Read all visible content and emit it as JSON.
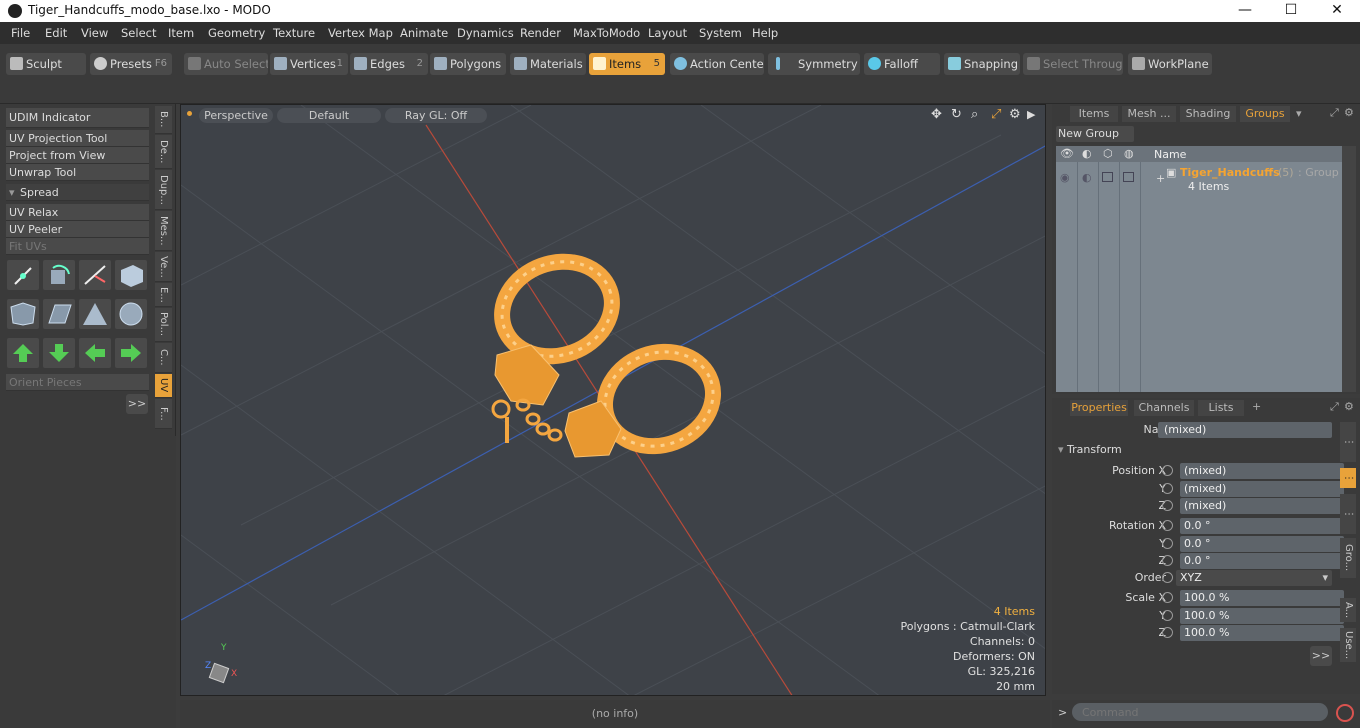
{
  "window": {
    "title": "Tiger_Handcuffs_modo_base.lxo - MODO",
    "min": "—",
    "max": "☐",
    "close": "✕"
  },
  "menu": [
    "File",
    "Edit",
    "View",
    "Select",
    "Item",
    "Geometry",
    "Texture",
    "Vertex Map",
    "Animate",
    "Dynamics",
    "Render",
    "MaxToModo",
    "Layout",
    "System",
    "Help"
  ],
  "toolbar": {
    "sculpt": "Sculpt",
    "presets": "Presets",
    "presets_key": "F6",
    "auto_select": "Auto Select",
    "vertices": "Vertices",
    "vertices_key": "1",
    "edges": "Edges",
    "edges_key": "2",
    "polygons": "Polygons",
    "materials": "Materials",
    "items": "Items",
    "items_key": "5",
    "action_center": "Action Center",
    "symmetry": "Symmetry",
    "falloff": "Falloff",
    "snapping": "Snapping",
    "select_through": "Select Through",
    "workplane": "WorkPlane"
  },
  "left_tools": {
    "udim": "UDIM Indicator",
    "uv_projection": "UV Projection Tool",
    "project_view": "Project from View",
    "unwrap": "Unwrap Tool",
    "spread": "Spread",
    "uv_relax": "UV Relax",
    "uv_peeler": "UV Peeler",
    "fit_uvs": "Fit UVs",
    "orient": "Orient Pieces",
    "more": ">>"
  },
  "left_vtabs": [
    "B...",
    "De...",
    "Dup...",
    "Mes...",
    "Ve...",
    "E...",
    "Pol...",
    "C...",
    "UV",
    "F..."
  ],
  "viewport": {
    "view": "Perspective",
    "shading": "Default",
    "raygl": "Ray GL: Off",
    "info_items": "4 Items",
    "info_polys": "Polygons : Catmull-Clark",
    "info_channels": "Channels: 0",
    "info_deformers": "Deformers: ON",
    "info_gl": "GL: 325,216",
    "info_scale": "20 mm",
    "axis_y": "Y",
    "axis_x": "X",
    "axis_z": "Z"
  },
  "right_top": {
    "tabs": [
      "Items",
      "Mesh ...",
      "Shading",
      "Groups"
    ],
    "new_group": "New Group",
    "col_name": "Name",
    "group_name": "Tiger_Handcuffs",
    "group_count": "(5)",
    "group_type": ": Group",
    "group_items": "4 Items"
  },
  "properties": {
    "tabs": [
      "Properties",
      "Channels",
      "Lists"
    ],
    "add_tab": "+",
    "name_label": "Name",
    "name_value": "(mixed)",
    "transform": "Transform",
    "position_x_label": "Position X",
    "y_label": "Y",
    "z_label": "Z",
    "pos_x": "(mixed)",
    "pos_y": "(mixed)",
    "pos_z": "(mixed)",
    "rotation_x_label": "Rotation X",
    "rot_x": "0.0 °",
    "rot_y": "0.0 °",
    "rot_z": "0.0 °",
    "order_label": "Order",
    "order_value": "XYZ",
    "scale_x_label": "Scale X",
    "scale_x": "100.0 %",
    "scale_y": "100.0 %",
    "scale_z": "100.0 %",
    "more": ">>",
    "vtabs": [
      "Gro...",
      "A...",
      "Use..."
    ]
  },
  "status": {
    "info": "(no info)",
    "command_placeholder": "Command",
    "prompt": ">"
  },
  "colors": {
    "accent": "#e8a23a",
    "viewport_bg": "#3e4248"
  }
}
